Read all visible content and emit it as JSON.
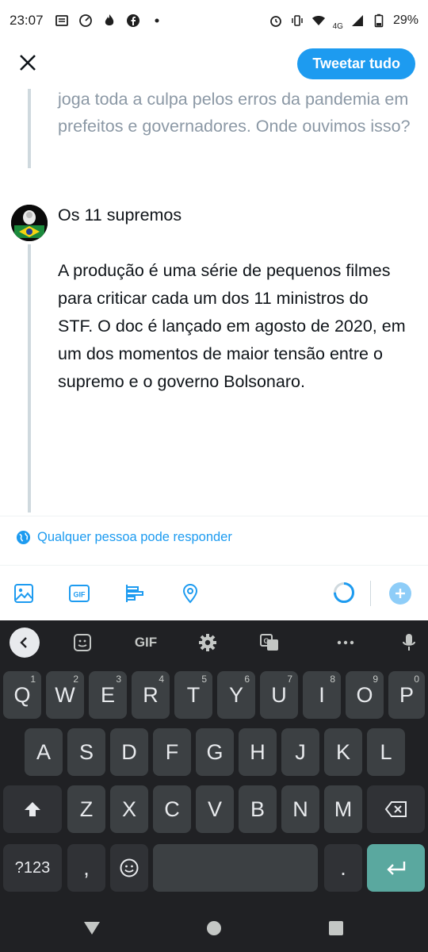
{
  "status_bar": {
    "time": "23:07",
    "left_icons": [
      "news-icon",
      "speed-icon",
      "flame-icon",
      "facebook-icon",
      "dot-icon"
    ],
    "network": "4G",
    "battery": "29%"
  },
  "header": {
    "tweet_all_label": "Tweetar tudo"
  },
  "thread": {
    "previous_text": "joga toda a culpa pelos erros da pandemia em prefeitos e governadores. Onde ouvimos isso?",
    "compose_text": "Os 11 supremos\n\nA produção é uma série de pequenos filmes para criticar cada um dos 11 ministros do STF. O doc é lançado em agosto de 2020, em um dos momentos de maior tensão entre o supremo e o governo Bolsonaro."
  },
  "reply_setting": {
    "label": "Qualquer pessoa pode responder"
  },
  "colors": {
    "accent": "#1d9bf0",
    "keyboard_bg": "#202124",
    "key_bg": "#3c4043",
    "enter_bg": "#5aa89f"
  },
  "keyboard": {
    "toolbar_gif": "GIF",
    "row1": [
      {
        "k": "Q",
        "h": "1"
      },
      {
        "k": "W",
        "h": "2"
      },
      {
        "k": "E",
        "h": "3"
      },
      {
        "k": "R",
        "h": "4"
      },
      {
        "k": "T",
        "h": "5"
      },
      {
        "k": "Y",
        "h": "6"
      },
      {
        "k": "U",
        "h": "7"
      },
      {
        "k": "I",
        "h": "8"
      },
      {
        "k": "O",
        "h": "9"
      },
      {
        "k": "P",
        "h": "0"
      }
    ],
    "row2": [
      "A",
      "S",
      "D",
      "F",
      "G",
      "H",
      "J",
      "K",
      "L"
    ],
    "row3": [
      "Z",
      "X",
      "C",
      "V",
      "B",
      "N",
      "M"
    ],
    "sym_label": "?123",
    "comma": ",",
    "period": "."
  }
}
